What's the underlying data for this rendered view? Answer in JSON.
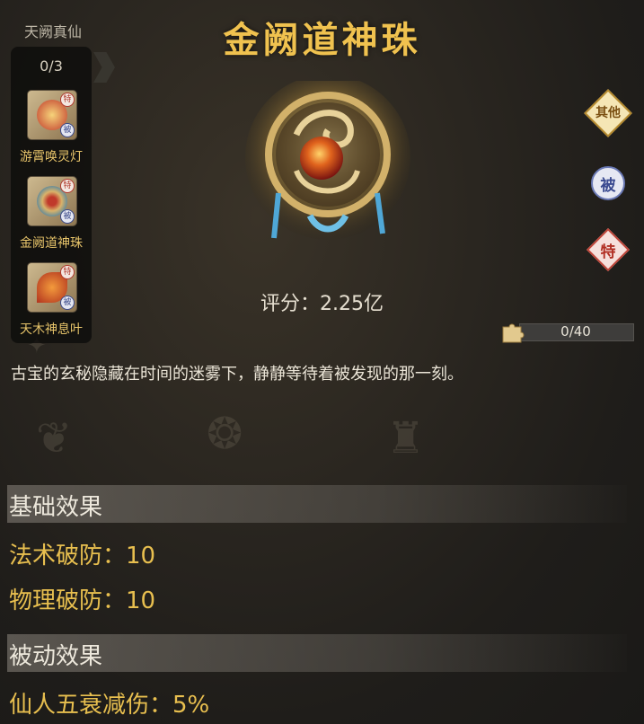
{
  "set": {
    "title": "天阙真仙",
    "count": "0/3",
    "items": [
      {
        "label": "游霄唤灵灯",
        "te": "特",
        "bei": "被"
      },
      {
        "label": "金阙道神珠",
        "te": "特",
        "bei": "被"
      },
      {
        "label": "天木神息叶",
        "te": "特",
        "bei": "被"
      }
    ]
  },
  "item": {
    "name": "金阙道神珠",
    "score_label": "评分：2.25亿",
    "description": "古宝的玄秘隐藏在时间的迷雾下，静静等待着被发现的那一刻。"
  },
  "tags": {
    "other": "其他",
    "passive": "被",
    "special": "特"
  },
  "fragments": {
    "text": "0/40",
    "current": 0,
    "total": 40
  },
  "basic": {
    "title": "基础效果",
    "effects": [
      "法术破防：10",
      "物理破防：10"
    ]
  },
  "passive": {
    "title": "被动效果",
    "effects": [
      "仙人五衰减伤：5%"
    ]
  },
  "colors": {
    "title": "#f0c24f",
    "effect": "#e8bf4f",
    "label": "#e7c46a"
  }
}
